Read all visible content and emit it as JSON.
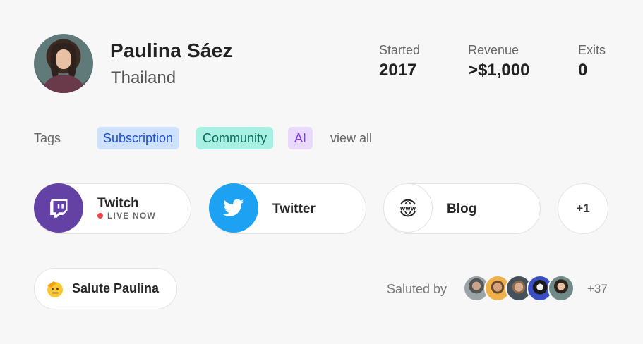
{
  "profile": {
    "name": "Paulina Sáez",
    "country": "Thailand"
  },
  "stats": {
    "started_label": "Started",
    "started_value": "2017",
    "revenue_label": "Revenue",
    "revenue_value": ">$1,000",
    "exits_label": "Exits",
    "exits_value": "0"
  },
  "tags": {
    "label": "Tags",
    "items": [
      "Subscription",
      "Community",
      "AI"
    ],
    "view_all": "view all"
  },
  "links": {
    "twitch_title": "Twitch",
    "twitch_status": "LIVE NOW",
    "twitter_title": "Twitter",
    "blog_title": "Blog",
    "more": "+1"
  },
  "salute": {
    "button_label": "Salute Paulina",
    "saluted_by": "Saluted by",
    "extra_count": "+37"
  },
  "colors": {
    "twitch": "#6441a5",
    "twitter": "#1da1f2",
    "live_dot": "#ef4444"
  },
  "icons": [
    "twitch-icon",
    "twitter-icon",
    "www-globe-icon",
    "saluting-face-icon"
  ]
}
